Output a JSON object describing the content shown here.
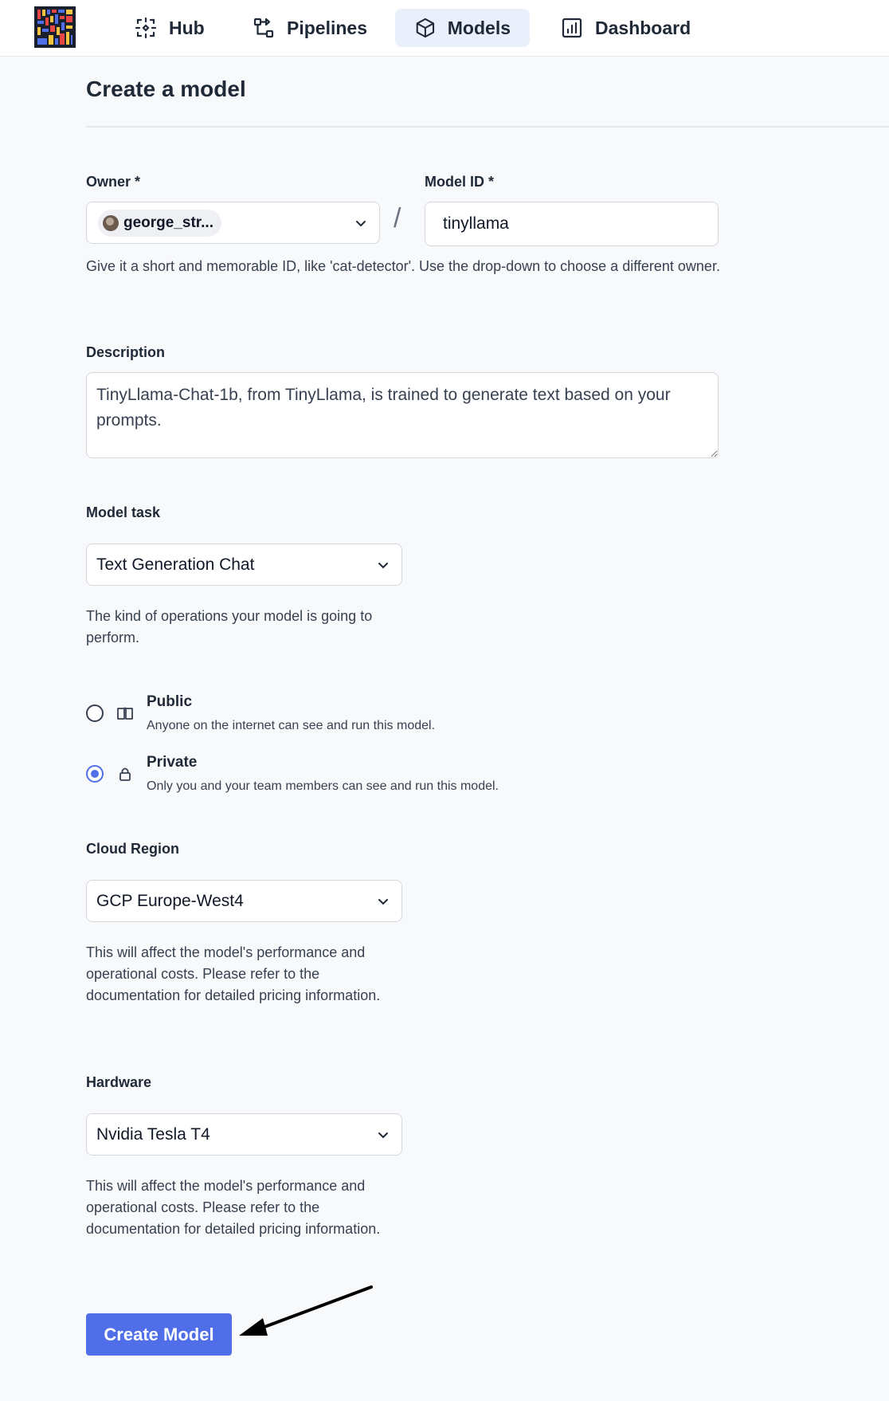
{
  "nav": {
    "items": [
      {
        "label": "Hub",
        "icon": "hub-icon"
      },
      {
        "label": "Pipelines",
        "icon": "pipelines-icon"
      },
      {
        "label": "Models",
        "icon": "cube-icon",
        "active": true
      },
      {
        "label": "Dashboard",
        "icon": "chart-icon"
      }
    ]
  },
  "page": {
    "title": "Create a model"
  },
  "owner": {
    "label": "Owner *",
    "value": "george_str..."
  },
  "model_id": {
    "label": "Model ID *",
    "value": "tinyllama"
  },
  "id_help": "Give it a short and memorable ID, like 'cat-detector'. Use the drop-down to choose a different owner.",
  "description": {
    "label": "Description",
    "value": "TinyLlama-Chat-1b, from TinyLlama, is trained to generate text based on your prompts."
  },
  "task": {
    "label": "Model task",
    "value": "Text Generation Chat",
    "help": "The kind of operations your model is going to perform."
  },
  "visibility": {
    "public": {
      "title": "Public",
      "desc": "Anyone on the internet can see and run this model.",
      "checked": false
    },
    "private": {
      "title": "Private",
      "desc": "Only you and your team members can see and run this model.",
      "checked": true
    }
  },
  "region": {
    "label": "Cloud Region",
    "value": "GCP Europe-West4",
    "help": "This will affect the model's performance and operational costs. Please refer to the documentation for detailed pricing information."
  },
  "hardware": {
    "label": "Hardware",
    "value": "Nvidia Tesla T4",
    "help": "This will affect the model's performance and operational costs. Please refer to the documentation for detailed pricing information."
  },
  "submit": {
    "label": "Create Model"
  },
  "colors": {
    "accent": "#4f6ee8",
    "active_nav_bg": "#eaf0fb"
  }
}
